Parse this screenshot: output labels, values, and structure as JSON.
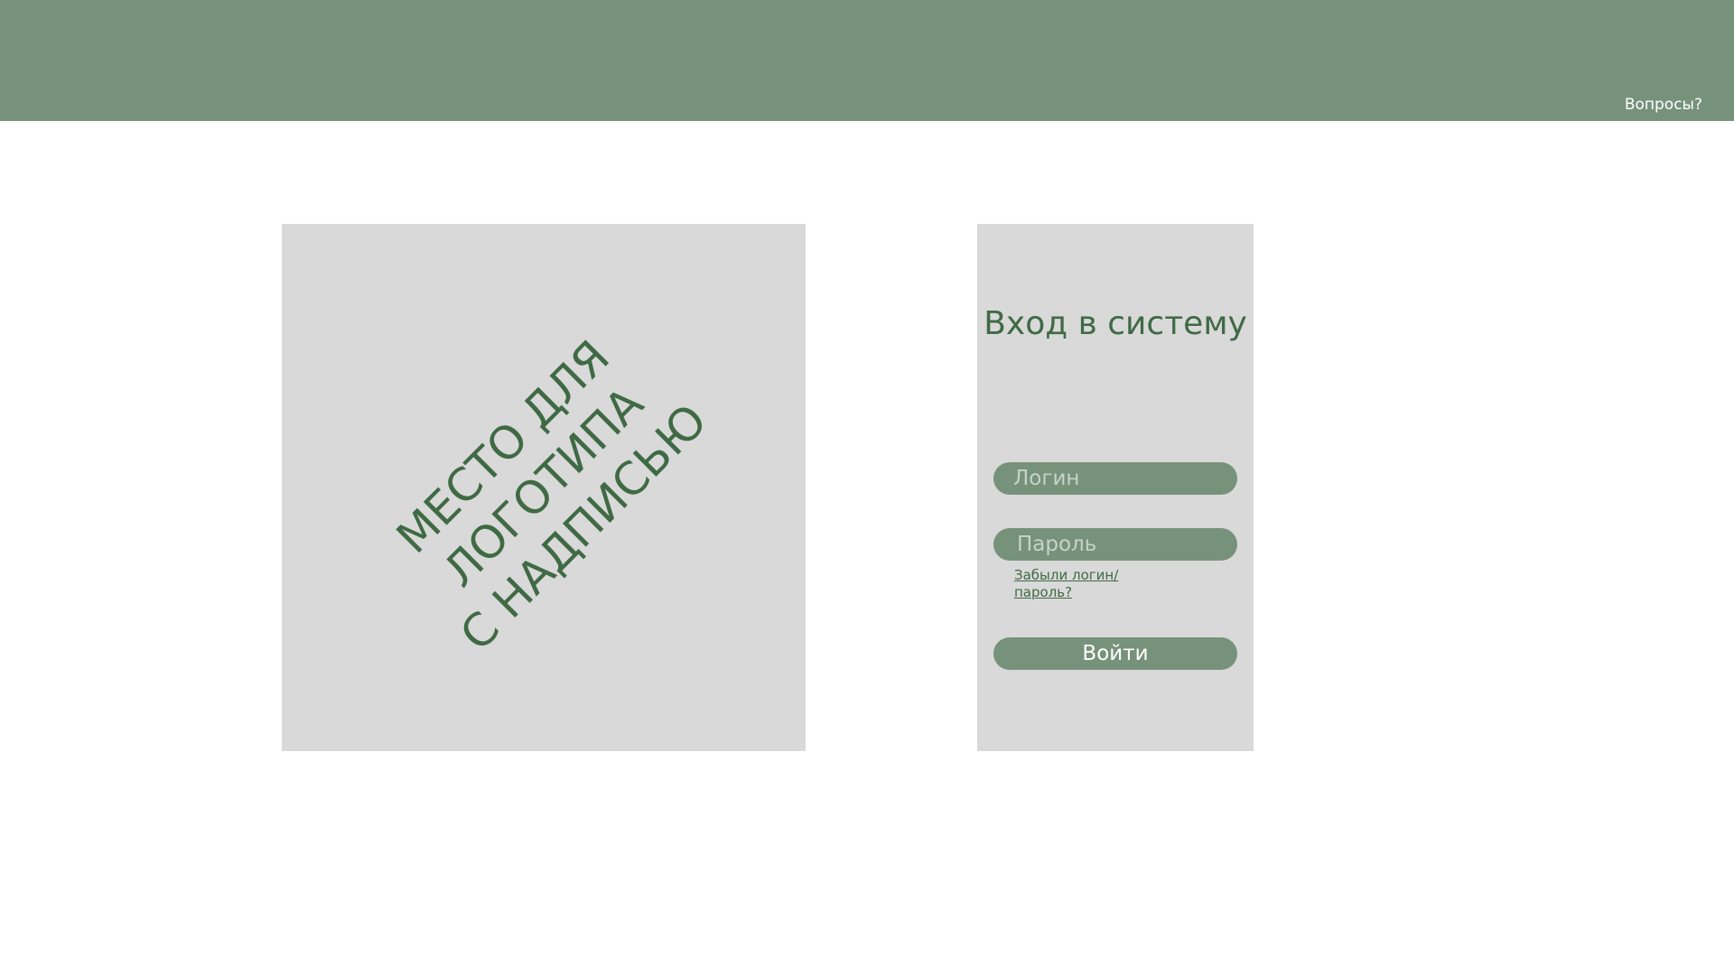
{
  "header": {
    "help_link": "Вопросы?"
  },
  "logo_placeholder": {
    "lines": [
      "МЕСТО ДЛЯ",
      "ЛОГОТИПА",
      "С НАДПИСЬЮ"
    ]
  },
  "login": {
    "title": "Вход в систему",
    "login_placeholder": "Логин",
    "password_placeholder": "Пароль",
    "forgot_line1": "Забыли логин/",
    "forgot_line2": "пароль?",
    "submit_label": "Войти"
  },
  "colors": {
    "header_bg": "#77927a",
    "panel_bg": "#d9d9d9",
    "accent_text": "#3f6a44",
    "field_bg": "#77927a"
  }
}
